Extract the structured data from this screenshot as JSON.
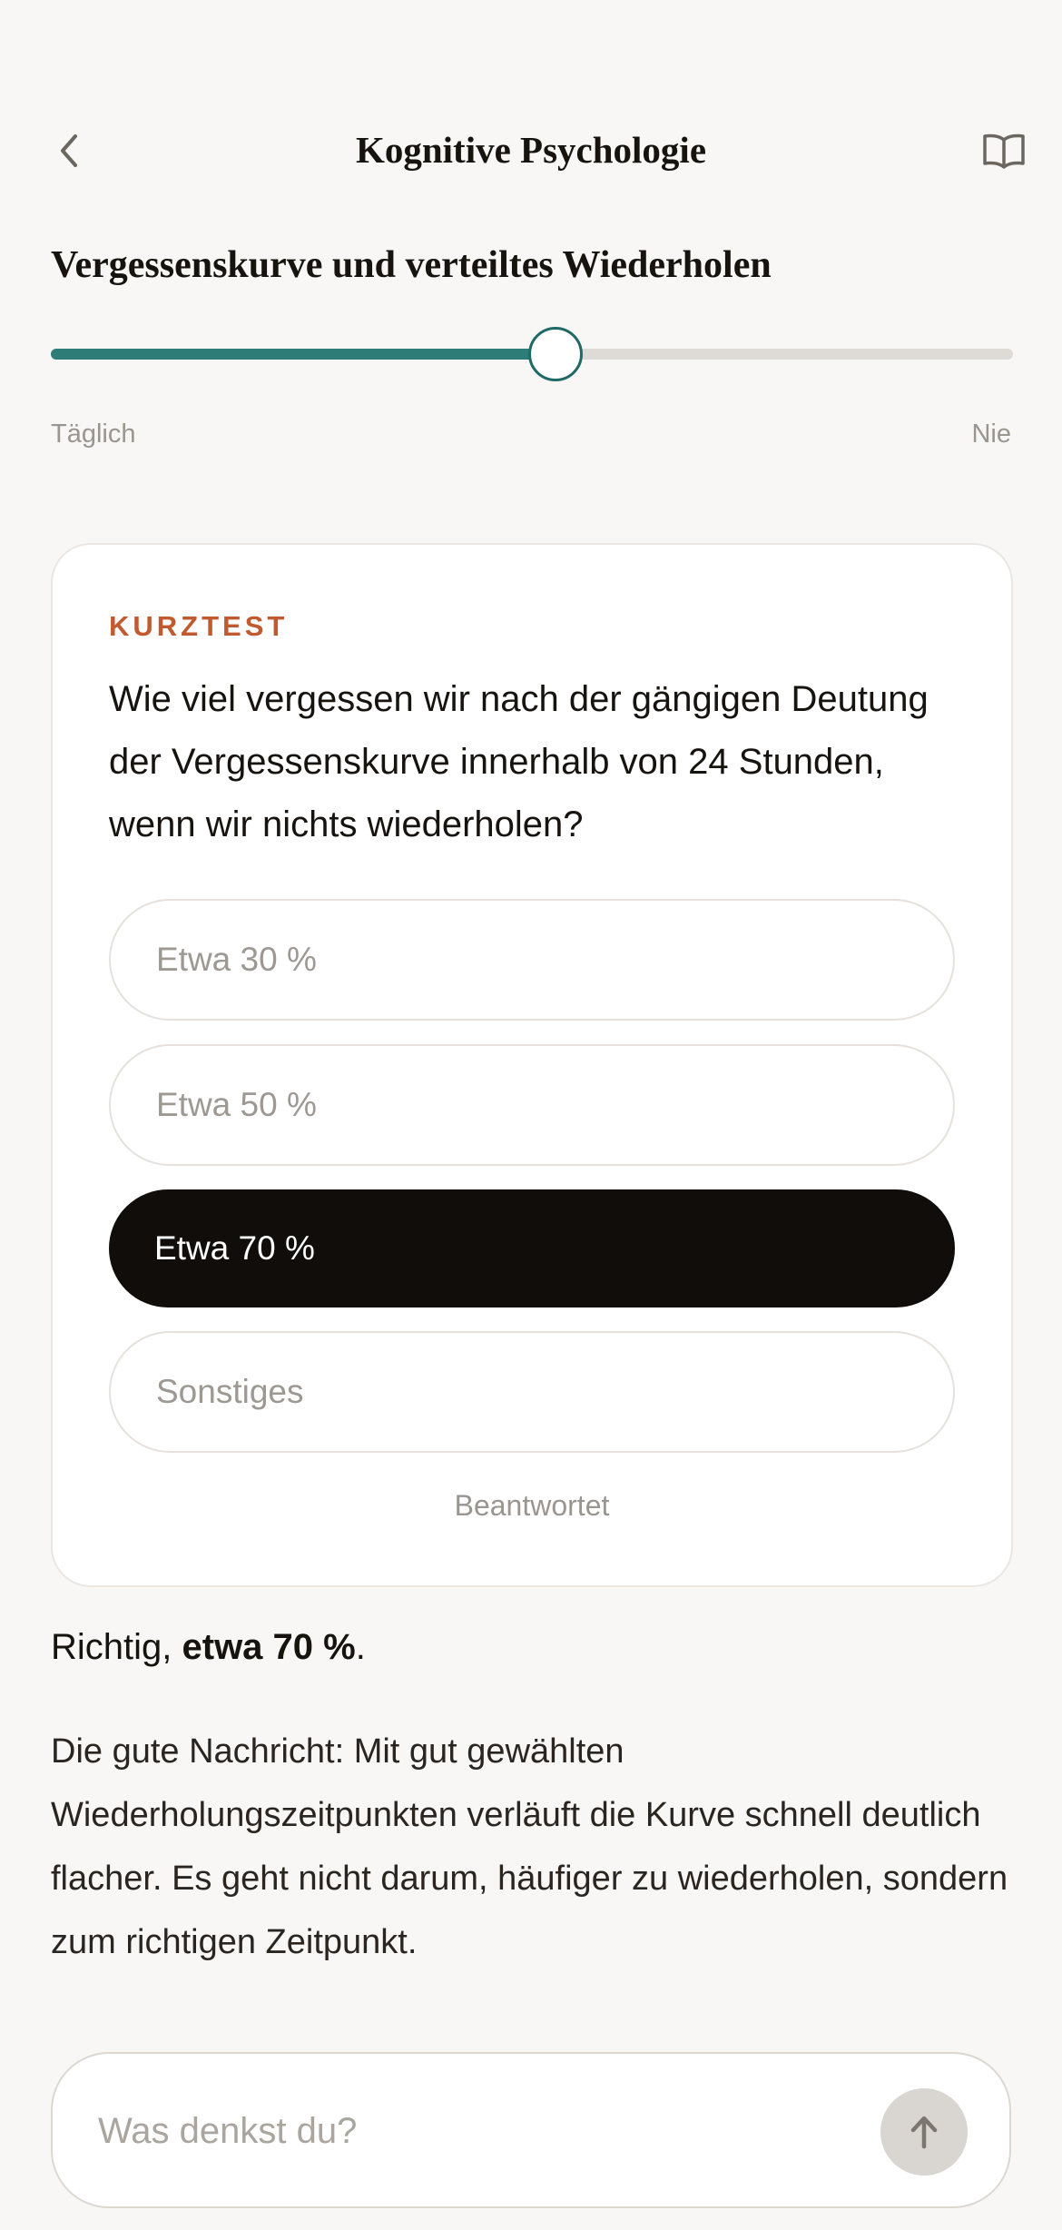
{
  "header": {
    "title": "Kognitive Psychologie",
    "back_icon": "chevron-left-icon",
    "book_icon": "book-open-icon"
  },
  "lesson": {
    "title": "Vergessenskurve und verteiltes Wiederholen"
  },
  "frequency_slider": {
    "min_label": "Täglich",
    "max_label": "Nie",
    "value_fraction": 0.524,
    "accent_color": "#2d7c78"
  },
  "quiz": {
    "tag": "KURZTEST",
    "question": "Wie viel vergessen wir nach der gängigen Deutung der Vergessenskurve innerhalb von 24 Stunden, wenn wir nichts wiederholen?",
    "options": [
      {
        "label": "Etwa 30 %",
        "selected": false
      },
      {
        "label": "Etwa 50 %",
        "selected": false
      },
      {
        "label": "Etwa 70 %",
        "selected": true
      },
      {
        "label": "Sonstiges",
        "selected": false
      }
    ],
    "status": "Beantwortet",
    "tag_color": "#c25a2f"
  },
  "feedback": {
    "prefix": "Richtig, ",
    "answer": "etwa 70 %",
    "suffix": "."
  },
  "explanation": "Die gute Nachricht: Mit gut gewählten Wiederholungszeitpunkten verläuft die Kurve schnell deutlich flacher. Es geht nicht darum, häufiger zu wiederholen, sondern zum richtigen Zeitpunkt.",
  "composer": {
    "placeholder": "Was denkst du?",
    "send_icon": "arrow-up-icon"
  }
}
